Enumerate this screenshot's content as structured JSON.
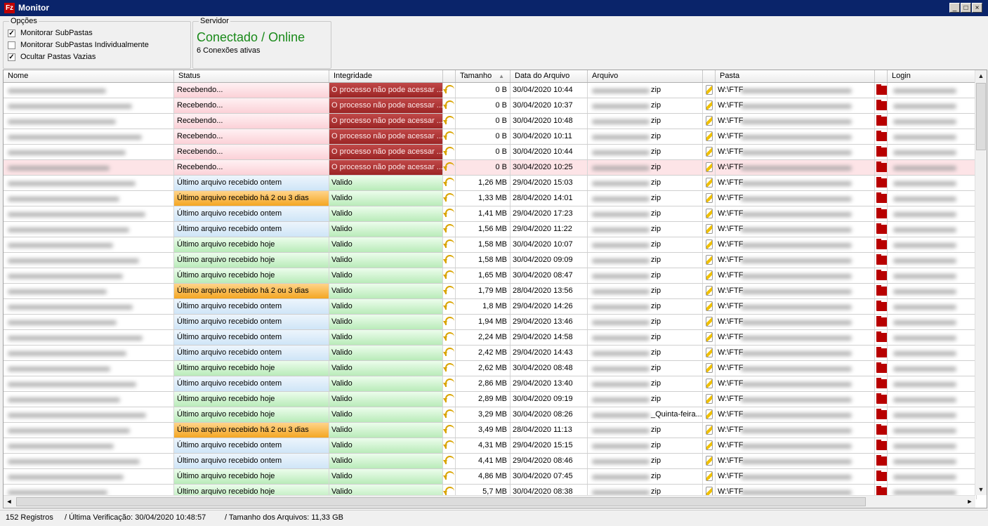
{
  "window": {
    "title": "Monitor",
    "icon": "filezilla-icon"
  },
  "options": {
    "legend": "Opções",
    "items": [
      {
        "label": "Monitorar SubPastas",
        "checked": true
      },
      {
        "label": "Monitorar SubPastas Individualmente",
        "checked": false
      },
      {
        "label": "Ocultar Pastas Vazias",
        "checked": true
      }
    ]
  },
  "server": {
    "legend": "Servidor",
    "status": "Conectado / Online",
    "connections": "6 Conexões ativas",
    "status_color": "#1a8a1a"
  },
  "table": {
    "columns": [
      "Nome",
      "Status",
      "Integridade",
      "",
      "Tamanho",
      "Data do Arquivo",
      "Arquivo",
      "",
      "Pasta",
      "",
      "Login"
    ],
    "sorted_column": "Tamanho",
    "rows": [
      {
        "status": "Recebendo...",
        "status_type": "receb",
        "integrity": "O processo não pode acessar ...",
        "integrity_type": "err",
        "size": "0 B",
        "date": "30/04/2020 10:44",
        "file": "zip",
        "folder": "W:\\FTF"
      },
      {
        "status": "Recebendo...",
        "status_type": "receb",
        "integrity": "O processo não pode acessar ...",
        "integrity_type": "err",
        "size": "0 B",
        "date": "30/04/2020 10:37",
        "file": "zip",
        "folder": "W:\\FTF"
      },
      {
        "status": "Recebendo...",
        "status_type": "receb",
        "integrity": "O processo não pode acessar ...",
        "integrity_type": "err",
        "size": "0 B",
        "date": "30/04/2020 10:48",
        "file": "zip",
        "folder": "W:\\FTF"
      },
      {
        "status": "Recebendo...",
        "status_type": "receb",
        "integrity": "O processo não pode acessar ...",
        "integrity_type": "err",
        "size": "0 B",
        "date": "30/04/2020 10:11",
        "file": "zip",
        "folder": "W:\\FTF"
      },
      {
        "status": "Recebendo...",
        "status_type": "receb",
        "integrity": "O processo não pode acessar ...",
        "integrity_type": "err",
        "size": "0 B",
        "date": "30/04/2020 10:44",
        "file": "zip",
        "folder": "W:\\FTF"
      },
      {
        "status": "Recebendo...",
        "status_type": "receb",
        "integrity": "O processo não pode acessar ...",
        "integrity_type": "err",
        "size": "0 B",
        "date": "30/04/2020 10:25",
        "file": "zip",
        "folder": "W:\\FTF",
        "selected": true
      },
      {
        "status": "Último arquivo recebido ontem",
        "status_type": "ontem",
        "integrity": "Valido",
        "integrity_type": "ok",
        "size": "1,26 MB",
        "date": "29/04/2020 15:03",
        "file": "zip",
        "folder": "W:\\FTF"
      },
      {
        "status": "Último arquivo recebido há 2 ou 3 dias",
        "status_type": "2ou3",
        "integrity": "Valido",
        "integrity_type": "ok",
        "size": "1,33 MB",
        "date": "28/04/2020 14:01",
        "file": "zip",
        "folder": "W:\\FTF"
      },
      {
        "status": "Último arquivo recebido ontem",
        "status_type": "ontem",
        "integrity": "Valido",
        "integrity_type": "ok",
        "size": "1,41 MB",
        "date": "29/04/2020 17:23",
        "file": "zip",
        "folder": "W:\\FTF"
      },
      {
        "status": "Último arquivo recebido ontem",
        "status_type": "ontem",
        "integrity": "Valido",
        "integrity_type": "ok",
        "size": "1,56 MB",
        "date": "29/04/2020 11:22",
        "file": "zip",
        "folder": "W:\\FTF"
      },
      {
        "status": "Último arquivo recebido hoje",
        "status_type": "hoje",
        "integrity": "Valido",
        "integrity_type": "ok",
        "size": "1,58 MB",
        "date": "30/04/2020 10:07",
        "file": "zip",
        "folder": "W:\\FTF"
      },
      {
        "status": "Último arquivo recebido hoje",
        "status_type": "hoje",
        "integrity": "Valido",
        "integrity_type": "ok",
        "size": "1,58 MB",
        "date": "30/04/2020 09:09",
        "file": "zip",
        "folder": "W:\\FTF"
      },
      {
        "status": "Último arquivo recebido hoje",
        "status_type": "hoje",
        "integrity": "Valido",
        "integrity_type": "ok",
        "size": "1,65 MB",
        "date": "30/04/2020 08:47",
        "file": "zip",
        "folder": "W:\\FTF"
      },
      {
        "status": "Último arquivo recebido há 2 ou 3 dias",
        "status_type": "2ou3",
        "integrity": "Valido",
        "integrity_type": "ok",
        "size": "1,79 MB",
        "date": "28/04/2020 13:56",
        "file": "zip",
        "folder": "W:\\FTF"
      },
      {
        "status": "Último arquivo recebido ontem",
        "status_type": "ontem",
        "integrity": "Valido",
        "integrity_type": "ok",
        "size": "1,8 MB",
        "date": "29/04/2020 14:26",
        "file": "zip",
        "folder": "W:\\FTF"
      },
      {
        "status": "Último arquivo recebido ontem",
        "status_type": "ontem",
        "integrity": "Valido",
        "integrity_type": "ok",
        "size": "1,94 MB",
        "date": "29/04/2020 13:46",
        "file": "zip",
        "folder": "W:\\FTF"
      },
      {
        "status": "Último arquivo recebido ontem",
        "status_type": "ontem",
        "integrity": "Valido",
        "integrity_type": "ok",
        "size": "2,24 MB",
        "date": "29/04/2020 14:58",
        "file": "zip",
        "folder": "W:\\FTF"
      },
      {
        "status": "Último arquivo recebido ontem",
        "status_type": "ontem",
        "integrity": "Valido",
        "integrity_type": "ok",
        "size": "2,42 MB",
        "date": "29/04/2020 14:43",
        "file": "zip",
        "folder": "W:\\FTF"
      },
      {
        "status": "Último arquivo recebido hoje",
        "status_type": "hoje",
        "integrity": "Valido",
        "integrity_type": "ok",
        "size": "2,62 MB",
        "date": "30/04/2020 08:48",
        "file": "zip",
        "folder": "W:\\FTF"
      },
      {
        "status": "Último arquivo recebido ontem",
        "status_type": "ontem",
        "integrity": "Valido",
        "integrity_type": "ok",
        "size": "2,86 MB",
        "date": "29/04/2020 13:40",
        "file": "zip",
        "folder": "W:\\FTF"
      },
      {
        "status": "Último arquivo recebido hoje",
        "status_type": "hoje",
        "integrity": "Valido",
        "integrity_type": "ok",
        "size": "2,89 MB",
        "date": "30/04/2020 09:19",
        "file": "zip",
        "folder": "W:\\FTF"
      },
      {
        "status": "Último arquivo recebido hoje",
        "status_type": "hoje",
        "integrity": "Valido",
        "integrity_type": "ok",
        "size": "3,29 MB",
        "date": "30/04/2020 08:26",
        "file": "_Quinta-feira...",
        "folder": "W:\\FTF"
      },
      {
        "status": "Último arquivo recebido há 2 ou 3 dias",
        "status_type": "2ou3",
        "integrity": "Valido",
        "integrity_type": "ok",
        "size": "3,49 MB",
        "date": "28/04/2020 11:13",
        "file": "zip",
        "folder": "W:\\FTF"
      },
      {
        "status": "Último arquivo recebido ontem",
        "status_type": "ontem",
        "integrity": "Valido",
        "integrity_type": "ok",
        "size": "4,31 MB",
        "date": "29/04/2020 15:15",
        "file": "zip",
        "folder": "W:\\FTF"
      },
      {
        "status": "Último arquivo recebido ontem",
        "status_type": "ontem",
        "integrity": "Valido",
        "integrity_type": "ok",
        "size": "4,41 MB",
        "date": "29/04/2020 08:46",
        "file": "zip",
        "folder": "W:\\FTF"
      },
      {
        "status": "Último arquivo recebido hoje",
        "status_type": "hoje",
        "integrity": "Valido",
        "integrity_type": "ok",
        "size": "4,86 MB",
        "date": "30/04/2020 07:45",
        "file": "zip",
        "folder": "W:\\FTF"
      },
      {
        "status": "Último arquivo recebido hoje",
        "status_type": "hoje",
        "integrity": "Valido",
        "integrity_type": "ok",
        "size": "5,7 MB",
        "date": "30/04/2020 08:38",
        "file": "zip",
        "folder": "W:\\FTF"
      }
    ]
  },
  "statusbar": {
    "records": "152 Registros",
    "last_check": "/   Última Verificação:  30/04/2020 10:48:57",
    "total_size": "/  Tamanho dos Arquivos:  11,33 GB"
  }
}
